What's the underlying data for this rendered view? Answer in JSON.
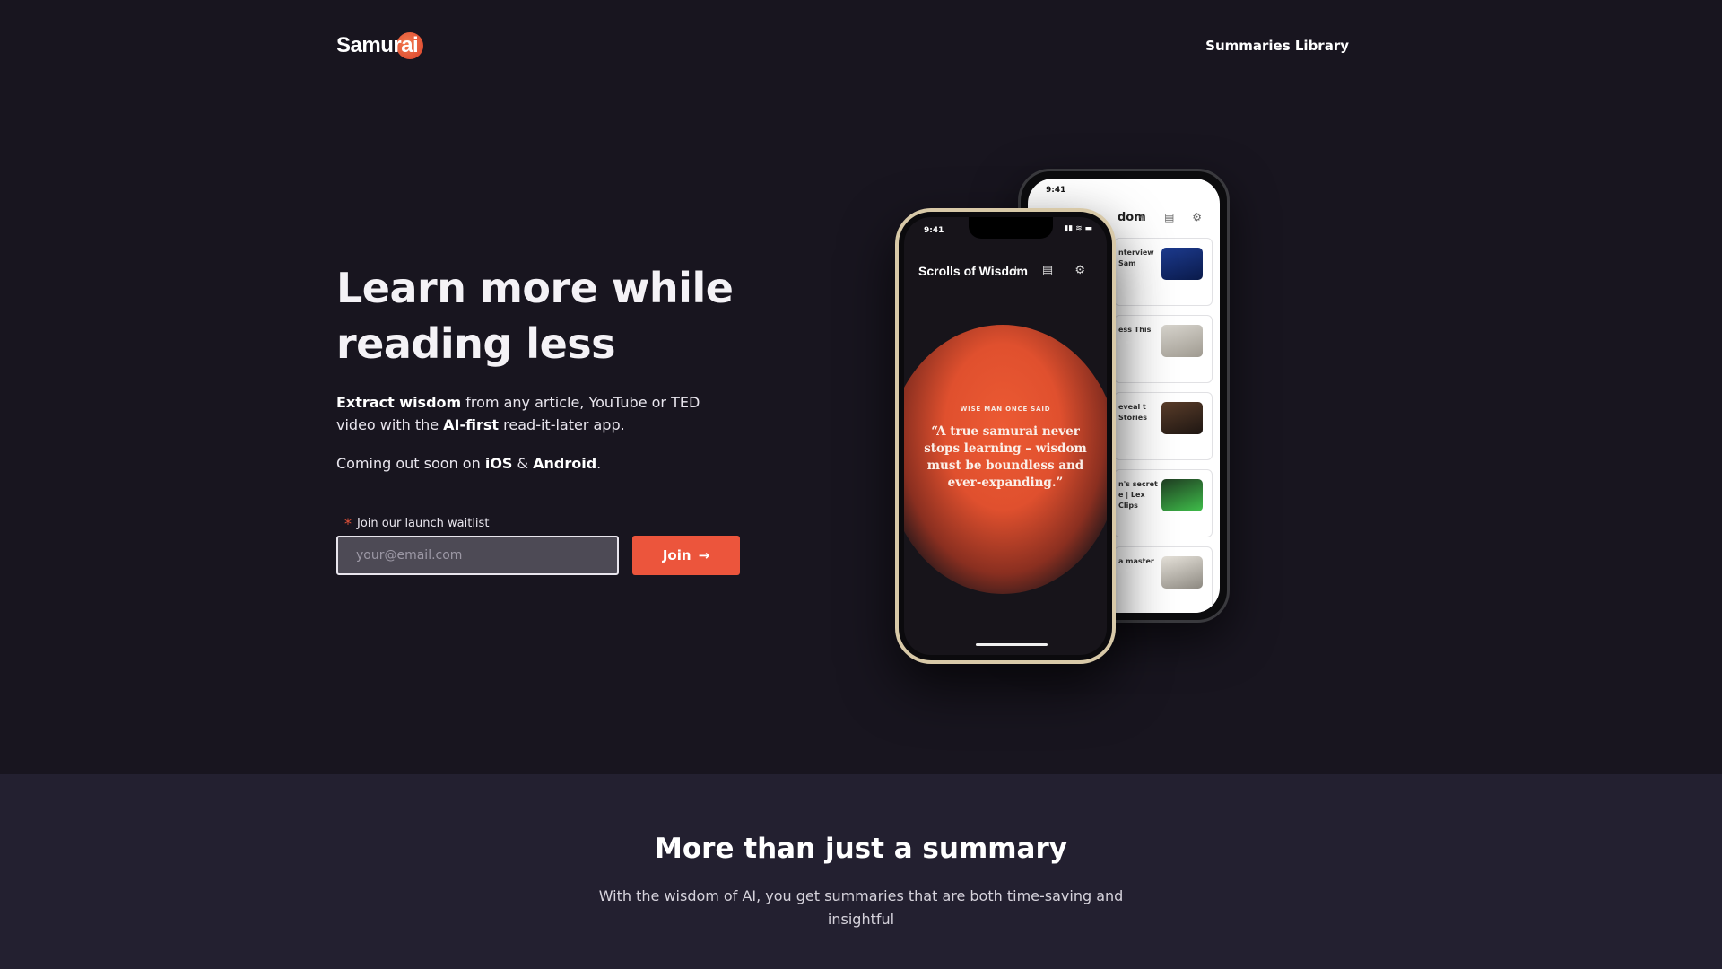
{
  "brand": {
    "name": "Samurai"
  },
  "nav": {
    "summaries_library": "Summaries Library"
  },
  "hero": {
    "headline": "Learn more while reading less",
    "line1_bold": "Extract wisdom",
    "line1_rest": " from any article, YouTube or TED video with the ",
    "line1_bold2": "AI-first",
    "line1_end": " read-it-later app.",
    "coming_pre": "Coming out soon on ",
    "ios": "iOS",
    "amp": " & ",
    "android": "Android",
    "coming_end": ".",
    "waitlist_label": "Join our launch waitlist",
    "required_mark": "*",
    "email_placeholder": "your@email.com",
    "join_label": "Join",
    "join_arrow": "→"
  },
  "phone_front": {
    "time": "9:41",
    "status_icons": "▮▮ ≋ ▬",
    "title": "Scrolls of Wisdom",
    "actions": "+ ▤ ⚙",
    "kicker": "WISE MAN ONCE SAID",
    "quote": "“A true samurai never stops learning – wisdom must be boundless and ever-expanding.”"
  },
  "phone_back": {
    "time": "9:41",
    "title_fragment": "dom",
    "actions": "+ ▤ ⚙",
    "cards": [
      {
        "text": "nterview Sam"
      },
      {
        "text": "ess This"
      },
      {
        "text": "eveal t Stories"
      },
      {
        "text": "n's secret e | Lex Clips"
      },
      {
        "text": "a master"
      }
    ]
  },
  "section": {
    "title": "More than just a summary",
    "subtitle": "With the wisdom of AI, you get summaries that are both time-saving and insightful"
  },
  "colors": {
    "background": "#18151f",
    "section_background": "#232030",
    "accent": "#ec553c"
  }
}
